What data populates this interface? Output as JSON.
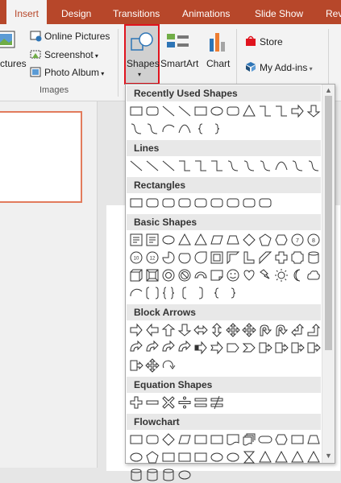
{
  "tabs": [
    {
      "label": "Insert",
      "active": true
    },
    {
      "label": "Design"
    },
    {
      "label": "Transitions"
    },
    {
      "label": "Animations"
    },
    {
      "label": "Slide Show"
    },
    {
      "label": "Rev"
    }
  ],
  "ribbon": {
    "pictures_label": "ctures",
    "online_pictures": "Online Pictures",
    "screenshot": "Screenshot",
    "photo_album": "Photo Album",
    "images_group": "Images",
    "shapes": "Shapes",
    "smartart": "SmartArt",
    "chart": "Chart",
    "store": "Store",
    "my_addins": "My Add-ins",
    "accent": "#b7472a",
    "highlight_border": "#e0141e"
  },
  "gallery": {
    "categories": [
      {
        "label": "Recently Used Shapes",
        "shape_rows": [
          [
            "rect",
            "roundrect",
            "line",
            "line",
            "rect",
            "ellipse",
            "roundrect",
            "triangle",
            "elbow",
            "elbow",
            "rightarrow",
            "downarrow"
          ],
          [
            "squiggle",
            "squiggle",
            "arc",
            "curve",
            "lbrace",
            "rbrace"
          ]
        ]
      },
      {
        "label": "Lines",
        "shape_rows": [
          [
            "line",
            "line",
            "line",
            "elbow",
            "elbow",
            "elbow",
            "squiggle",
            "squiggle",
            "squiggle",
            "curve",
            "squiggle",
            "squiggle"
          ]
        ]
      },
      {
        "label": "Rectangles",
        "shape_rows": [
          [
            "rect",
            "roundrect",
            "roundrect",
            "roundrect",
            "roundrect",
            "roundrect",
            "roundrect",
            "roundrect",
            "roundrect"
          ]
        ]
      },
      {
        "label": "Basic Shapes",
        "shape_rows": [
          [
            "textbox",
            "textbox",
            "ellipse",
            "triangle",
            "triangle",
            "parallelogram",
            "trapezoid",
            "diamond",
            "pentagon",
            "hexagon",
            "heptagon",
            "octagon"
          ],
          [
            "decagon",
            "dodecagon",
            "pie",
            "chord",
            "teardrop",
            "frame",
            "halfframe",
            "lshape",
            "diagstripe",
            "cross",
            "plaque",
            "can"
          ],
          [
            "cube",
            "bevel",
            "donut",
            "nosymbol",
            "blockarc",
            "foldedcorner",
            "smiley",
            "heart",
            "lightning",
            "sun",
            "moon",
            "cloud"
          ],
          [
            "arc",
            "bracketpair",
            "bracepair",
            "lbracket",
            "rbracket",
            "lbrace",
            "rbrace"
          ]
        ]
      },
      {
        "label": "Block Arrows",
        "shape_rows": [
          [
            "rightarrow",
            "leftarrow",
            "uparrow",
            "downarrow",
            "leftrightarrow",
            "updownarrow",
            "quadarrow",
            "quadarrow",
            "uturnarrow",
            "uturnarrow",
            "leftuparrow",
            "bentuparrow"
          ],
          [
            "curvedarrow",
            "curvedarrow",
            "curvedarrow",
            "curvedarrow",
            "stripedarrow",
            "notchedarrow",
            "pentagonarrow",
            "chevron",
            "callout",
            "callout",
            "callout",
            "callout"
          ],
          [
            "callout",
            "quadarrow",
            "circulararrow"
          ]
        ]
      },
      {
        "label": "Equation Shapes",
        "shape_rows": [
          [
            "plus",
            "minus",
            "multiply",
            "divide",
            "equal",
            "notequal"
          ]
        ]
      },
      {
        "label": "Flowchart",
        "shape_rows": [
          [
            "rect",
            "roundrect",
            "diamond",
            "parallelogram",
            "rect",
            "rect",
            "document",
            "multidoc",
            "terminator",
            "hexagon",
            "rect",
            "trapezoid"
          ],
          [
            "ellipse",
            "pentagon",
            "rect",
            "rect",
            "rect",
            "ellipse",
            "ellipse",
            "hourglass",
            "triangle",
            "triangle",
            "triangle",
            "triangle"
          ],
          [
            "can",
            "can",
            "can",
            "ellipse"
          ]
        ]
      }
    ]
  }
}
